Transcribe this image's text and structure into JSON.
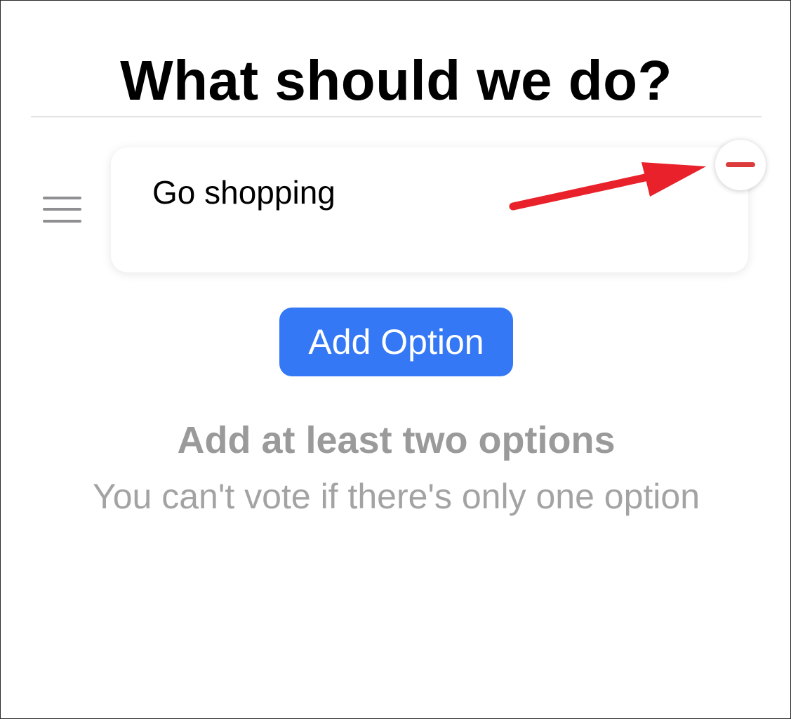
{
  "header": {
    "title": "What should we do?"
  },
  "options": [
    {
      "value": "Go shopping"
    }
  ],
  "actions": {
    "add_option_label": "Add Option"
  },
  "hint": {
    "title": "Add at least two options",
    "subtitle": "You can't vote if there's only one option"
  },
  "icons": {
    "drag": "drag-handle-icon",
    "remove": "minus-circle-icon",
    "annotation": "red-arrow-annotation"
  },
  "colors": {
    "accent": "#3478f6",
    "remove": "#dc3b3b",
    "annotation_arrow": "#e8212b",
    "hint_text": "#9a9a9a"
  }
}
